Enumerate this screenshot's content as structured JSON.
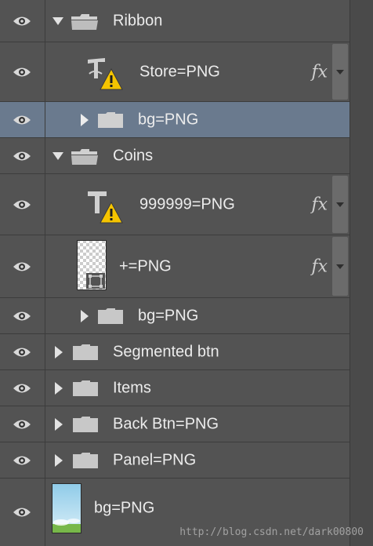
{
  "layers": [
    {
      "label": "Ribbon",
      "kind": "group",
      "expanded": true,
      "icon": "folder-open-icon"
    },
    {
      "label": "Store=PNG",
      "kind": "text",
      "warning": true,
      "fx": "fx",
      "icon": "text-layer-warning-icon"
    },
    {
      "label": "bg=PNG",
      "kind": "group",
      "expanded": false,
      "selected": true,
      "icon": "folder-icon"
    },
    {
      "label": "Coins",
      "kind": "group",
      "expanded": true,
      "icon": "folder-open-icon"
    },
    {
      "label": "999999=PNG",
      "kind": "text",
      "warning": true,
      "fx": "fx",
      "icon": "text-layer-warning-icon"
    },
    {
      "label": "+=PNG",
      "kind": "smart-object",
      "fx": "fx",
      "icon": "transparent-thumbnail-icon"
    },
    {
      "label": "bg=PNG",
      "kind": "group",
      "expanded": false,
      "icon": "folder-icon"
    },
    {
      "label": "Segmented btn",
      "kind": "group",
      "expanded": false,
      "icon": "folder-icon"
    },
    {
      "label": "Items",
      "kind": "group",
      "expanded": false,
      "icon": "folder-icon"
    },
    {
      "label": "Back Btn=PNG",
      "kind": "group",
      "expanded": false,
      "icon": "folder-icon"
    },
    {
      "label": "Panel=PNG",
      "kind": "group",
      "expanded": false,
      "icon": "folder-icon"
    },
    {
      "label": "bg=PNG",
      "kind": "image",
      "icon": "sky-thumbnail-icon"
    }
  ],
  "watermark": "http://blog.csdn.net/dark00800",
  "colors": {
    "panel": "#535353",
    "selected": "#6a7a8e",
    "divider": "#3c3c3c",
    "warning": "#f5c400"
  }
}
